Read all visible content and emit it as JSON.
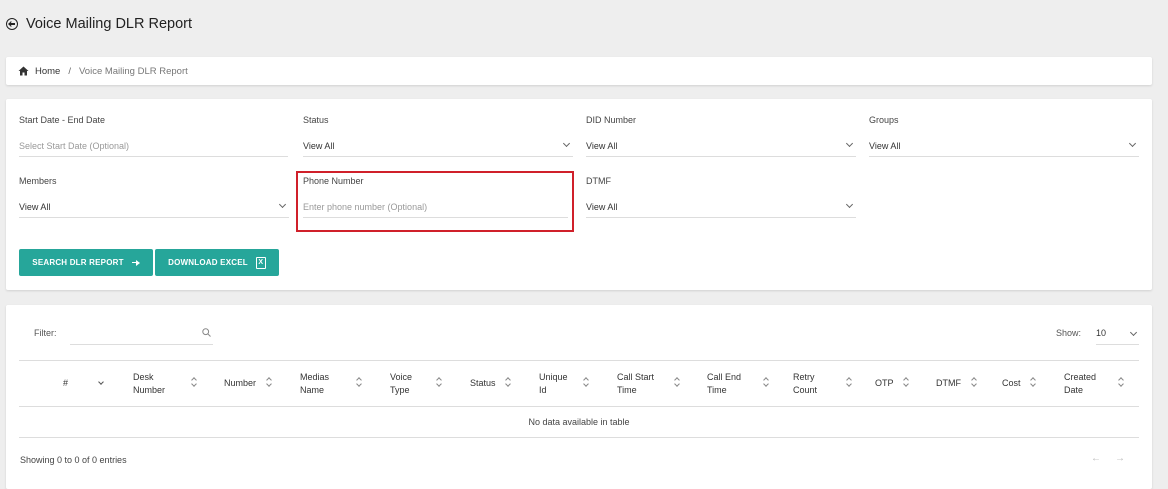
{
  "header": {
    "title": "Voice Mailing DLR Report"
  },
  "breadcrumb": {
    "home": "Home",
    "separator": "/",
    "current": "Voice Mailing DLR Report"
  },
  "filters": {
    "date_range": {
      "label": "Start Date - End Date",
      "placeholder": "Select Start Date (Optional)"
    },
    "status": {
      "label": "Status",
      "value": "View All"
    },
    "did_number": {
      "label": "DID Number",
      "value": "View All"
    },
    "groups": {
      "label": "Groups",
      "value": "View All"
    },
    "members": {
      "label": "Members",
      "value": "View All"
    },
    "phone_number": {
      "label": "Phone Number",
      "placeholder": "Enter phone number (Optional)"
    },
    "dtmf": {
      "label": "DTMF",
      "value": "View All"
    }
  },
  "buttons": {
    "search": "SEARCH DLR REPORT",
    "download": "DOWNLOAD EXCEL",
    "excel_glyph": "X"
  },
  "table": {
    "filter_label": "Filter:",
    "show_label": "Show:",
    "show_value": "10",
    "columns": {
      "index": "#",
      "desk_number_1": "Desk",
      "desk_number_2": "Number",
      "number": "Number",
      "medias_name_1": "Medias",
      "medias_name_2": "Name",
      "voice_type_1": "Voice",
      "voice_type_2": "Type",
      "status": "Status",
      "unique_id_1": "Unique",
      "unique_id_2": "Id",
      "call_start_1": "Call Start",
      "call_start_2": "Time",
      "call_end_1": "Call End",
      "call_end_2": "Time",
      "retry_count_1": "Retry",
      "retry_count_2": "Count",
      "otp": "OTP",
      "dtmf": "DTMF",
      "cost": "Cost",
      "created_date_1": "Created",
      "created_date_2": "Date"
    },
    "empty_message": "No data available in table",
    "info": "Showing 0 to 0 of 0 entries",
    "prev": "←",
    "next": "→"
  },
  "colors": {
    "accent": "#26a69a",
    "highlight": "#d0202a"
  }
}
